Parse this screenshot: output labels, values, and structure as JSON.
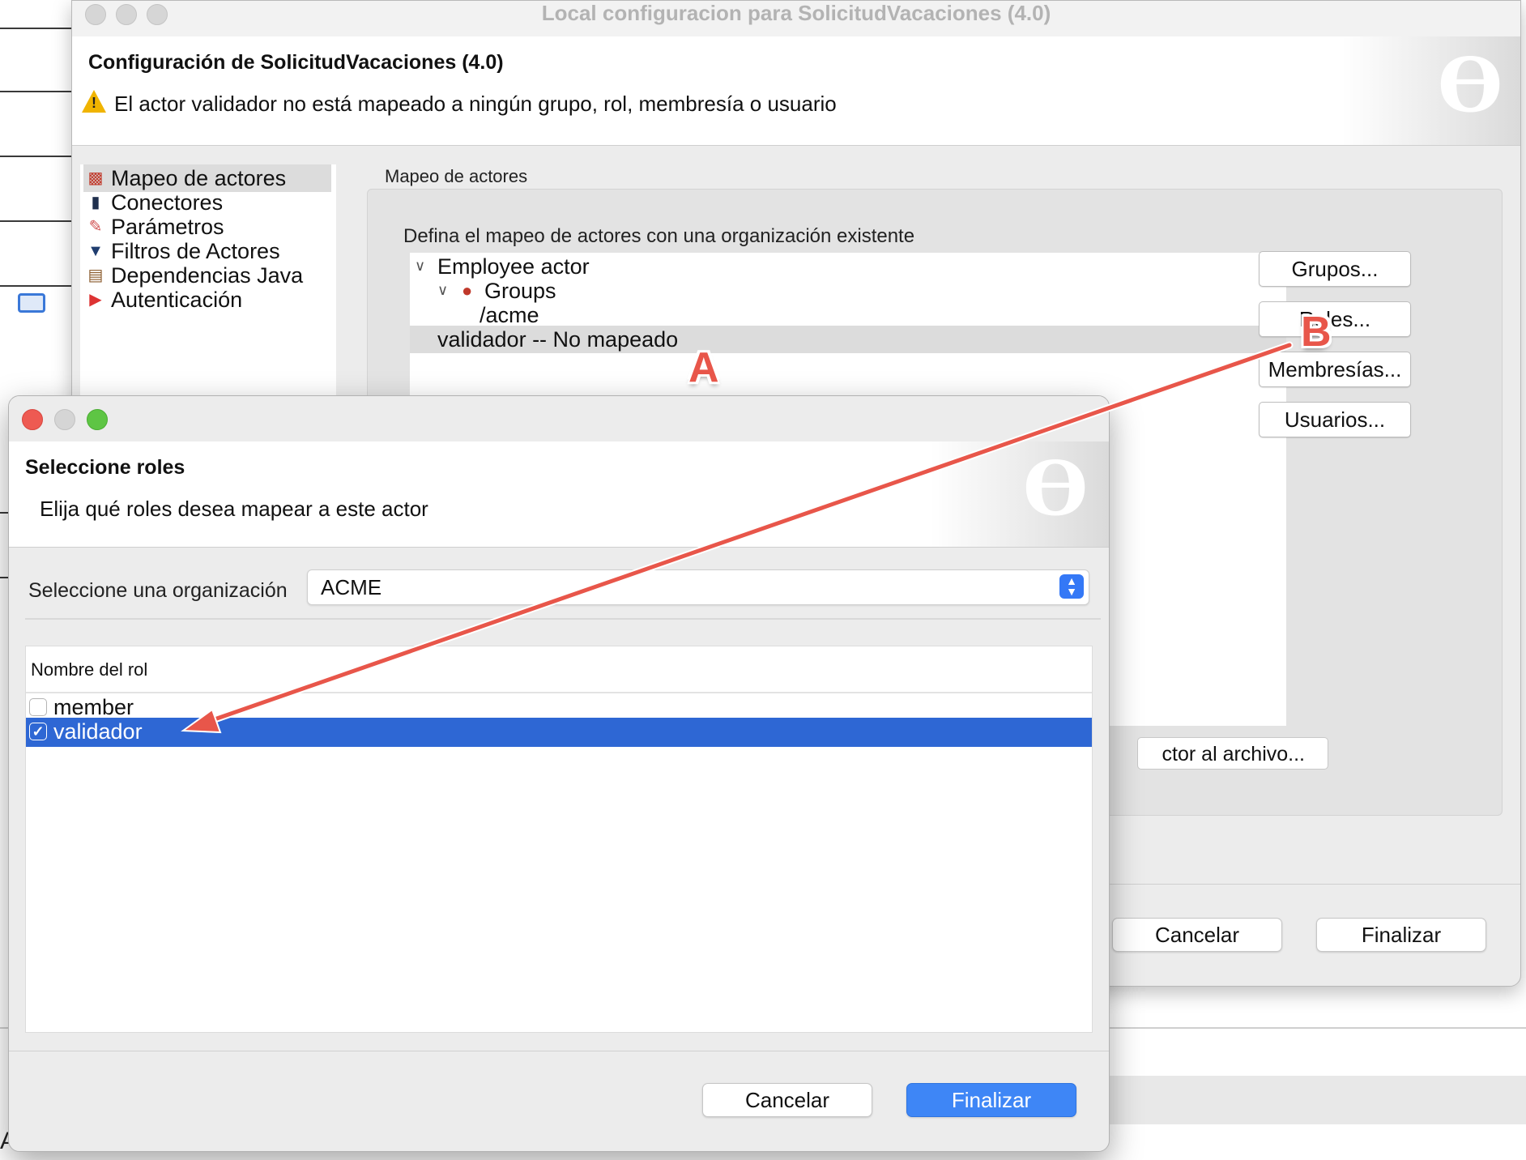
{
  "background_app": {
    "bottom_label": "Actores"
  },
  "back_window": {
    "title": "Local configuracion para  SolicitudVacaciones (4.0)",
    "header": {
      "title": "Configuración de SolicitudVacaciones (4.0)",
      "warning": "El actor validador no está mapeado a ningún grupo, rol, membresía o usuario"
    },
    "nav": [
      {
        "label": "Mapeo de actores",
        "icon": "actor-mapping-icon",
        "selected": true
      },
      {
        "label": "Conectores",
        "icon": "connector-plug-icon"
      },
      {
        "label": "Parámetros",
        "icon": "parameters-icon"
      },
      {
        "label": "Filtros de Actores",
        "icon": "filter-funnel-icon"
      },
      {
        "label": "Dependencias Java",
        "icon": "java-books-icon"
      },
      {
        "label": "Autenticación",
        "icon": "authentication-icon"
      }
    ],
    "section_title": "Mapeo de actores",
    "section_description": "Defina el mapeo de actores con una organización existente",
    "tree": [
      {
        "label": "Employee actor",
        "level": 0,
        "expanded": true
      },
      {
        "label": "Groups",
        "level": 1,
        "expanded": true,
        "icon": "groups-icon"
      },
      {
        "label": "/acme",
        "level": 2
      },
      {
        "label": "validador -- No mapeado",
        "level": 0,
        "selected": true
      }
    ],
    "side_buttons": {
      "groups": "Grupos...",
      "roles": "Roles...",
      "memberships": "Membresías...",
      "users": "Usuarios..."
    },
    "export_button": "ctor al archivo...",
    "cancel": "Cancelar",
    "finish": "Finalizar"
  },
  "dialog": {
    "header": {
      "title": "Seleccione roles",
      "subtitle": "Elija qué roles desea mapear a este actor"
    },
    "org_label": "Seleccione una organización",
    "org_value": "ACME",
    "table": {
      "column": "Nombre del rol",
      "rows": [
        {
          "label": "member",
          "checked": false
        },
        {
          "label": "validador",
          "checked": true,
          "selected": true
        }
      ]
    },
    "cancel": "Cancelar",
    "finish": "Finalizar"
  },
  "annotations": {
    "a": "A",
    "b": "B"
  },
  "colors": {
    "selection_blue": "#2e67d4",
    "primary_button": "#3e86f6",
    "annotation_red": "#e8564a",
    "warning_yellow": "#f0b400"
  }
}
